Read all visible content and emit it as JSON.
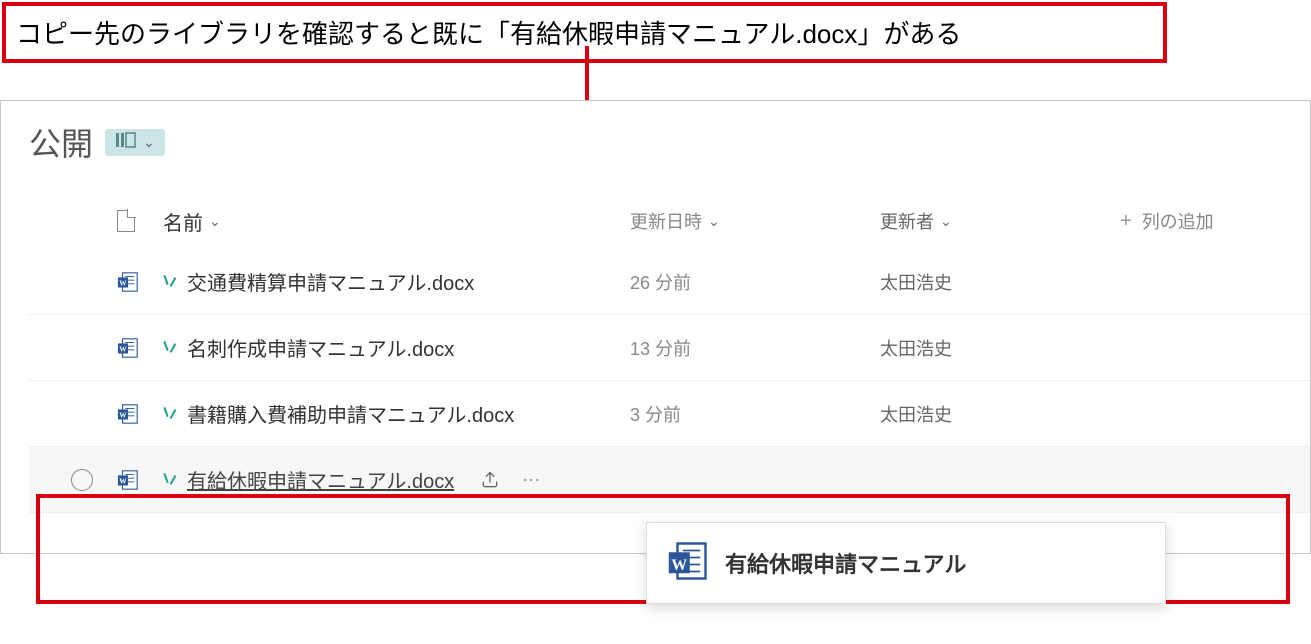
{
  "annotation": {
    "text": "コピー先のライブラリを確認すると既に「有給休暇申請マニュアル.docx」がある"
  },
  "library": {
    "title": "公開",
    "view_switch_label": "⊪\\"
  },
  "columns": {
    "name": "名前",
    "modified": "更新日時",
    "modified_by": "更新者",
    "add_column": "列の追加"
  },
  "rows": [
    {
      "name": "交通費精算申請マニュアル.docx",
      "modified": "26 分前",
      "by": "太田浩史"
    },
    {
      "name": "名刺作成申請マニュアル.docx",
      "modified": "13 分前",
      "by": "太田浩史"
    },
    {
      "name": "書籍購入費補助申請マニュアル.docx",
      "modified": "3 分前",
      "by": "太田浩史"
    },
    {
      "name": "有給休暇申請マニュアル.docx",
      "modified": "",
      "by": ""
    }
  ],
  "popup": {
    "title": "有給休暇申請マニュアル"
  },
  "glyphs": {
    "chevron_down": "⌄",
    "more": "···"
  }
}
